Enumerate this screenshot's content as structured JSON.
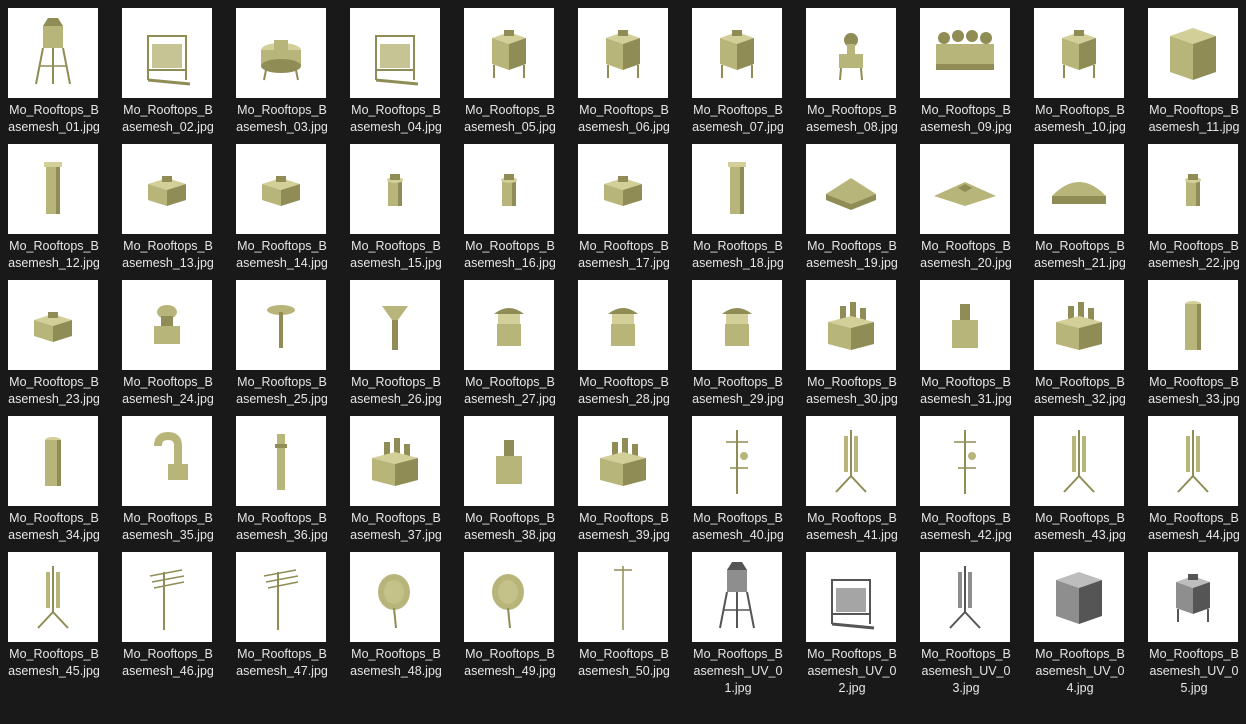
{
  "colors": {
    "background": "#191919",
    "thumb_background": "#ffffff",
    "label_text": "#e6e6e6",
    "model_fill": "#b8b57a",
    "model_shadow": "#8f8c55",
    "model_light": "#d2cf98",
    "uv_fill": "#8e8e8e",
    "uv_dark": "#555555"
  },
  "files": [
    {
      "name": "Mo_Rooftops_Basemesh_01.jpg",
      "icon": "water-tower-icon",
      "kind": "tower"
    },
    {
      "name": "Mo_Rooftops_Basemesh_02.jpg",
      "icon": "cooling-unit-frame-icon",
      "kind": "frame"
    },
    {
      "name": "Mo_Rooftops_Basemesh_03.jpg",
      "icon": "round-cooling-tower-icon",
      "kind": "drum"
    },
    {
      "name": "Mo_Rooftops_Basemesh_04.jpg",
      "icon": "cooling-unit-stand-icon",
      "kind": "frame"
    },
    {
      "name": "Mo_Rooftops_Basemesh_05.jpg",
      "icon": "box-unit-stand-icon",
      "kind": "box"
    },
    {
      "name": "Mo_Rooftops_Basemesh_06.jpg",
      "icon": "box-unit-legs-icon",
      "kind": "box"
    },
    {
      "name": "Mo_Rooftops_Basemesh_07.jpg",
      "icon": "tall-cooling-unit-icon",
      "kind": "box"
    },
    {
      "name": "Mo_Rooftops_Basemesh_08.jpg",
      "icon": "fan-stand-icon",
      "kind": "fanstand"
    },
    {
      "name": "Mo_Rooftops_Basemesh_09.jpg",
      "icon": "multi-fan-unit-icon",
      "kind": "multifan"
    },
    {
      "name": "Mo_Rooftops_Basemesh_10.jpg",
      "icon": "pipe-unit-icon",
      "kind": "box"
    },
    {
      "name": "Mo_Rooftops_Basemesh_11.jpg",
      "icon": "cube-unit-icon",
      "kind": "cube"
    },
    {
      "name": "Mo_Rooftops_Basemesh_12.jpg",
      "icon": "vent-column-icon",
      "kind": "column"
    },
    {
      "name": "Mo_Rooftops_Basemesh_13.jpg",
      "icon": "vent-box-icon",
      "kind": "lowbox"
    },
    {
      "name": "Mo_Rooftops_Basemesh_14.jpg",
      "icon": "vent-box-icon",
      "kind": "lowbox"
    },
    {
      "name": "Mo_Rooftops_Basemesh_15.jpg",
      "icon": "small-vent-icon",
      "kind": "smallvent"
    },
    {
      "name": "Mo_Rooftops_Basemesh_16.jpg",
      "icon": "small-vent-icon",
      "kind": "smallvent"
    },
    {
      "name": "Mo_Rooftops_Basemesh_17.jpg",
      "icon": "double-box-icon",
      "kind": "lowbox"
    },
    {
      "name": "Mo_Rooftops_Basemesh_18.jpg",
      "icon": "vent-column-icon",
      "kind": "column"
    },
    {
      "name": "Mo_Rooftops_Basemesh_19.jpg",
      "icon": "roof-hatch-icon",
      "kind": "hatch"
    },
    {
      "name": "Mo_Rooftops_Basemesh_20.jpg",
      "icon": "flat-hatch-icon",
      "kind": "flathatch"
    },
    {
      "name": "Mo_Rooftops_Basemesh_21.jpg",
      "icon": "barrel-roof-icon",
      "kind": "barrel"
    },
    {
      "name": "Mo_Rooftops_Basemesh_22.jpg",
      "icon": "fan-box-icon",
      "kind": "smallvent"
    },
    {
      "name": "Mo_Rooftops_Basemesh_23.jpg",
      "icon": "fan-box-icon",
      "kind": "lowbox"
    },
    {
      "name": "Mo_Rooftops_Basemesh_24.jpg",
      "icon": "mushroom-vent-icon",
      "kind": "mushroom"
    },
    {
      "name": "Mo_Rooftops_Basemesh_25.jpg",
      "icon": "pole-vent-icon",
      "kind": "polevent"
    },
    {
      "name": "Mo_Rooftops_Basemesh_26.jpg",
      "icon": "funnel-vent-icon",
      "kind": "funnel"
    },
    {
      "name": "Mo_Rooftops_Basemesh_27.jpg",
      "icon": "chimney-cap-icon",
      "kind": "chimneycap"
    },
    {
      "name": "Mo_Rooftops_Basemesh_28.jpg",
      "icon": "chimney-cap-icon",
      "kind": "chimneycap"
    },
    {
      "name": "Mo_Rooftops_Basemesh_29.jpg",
      "icon": "arched-cap-icon",
      "kind": "chimneycap"
    },
    {
      "name": "Mo_Rooftops_Basemesh_30.jpg",
      "icon": "multi-chimney-icon",
      "kind": "multichimney"
    },
    {
      "name": "Mo_Rooftops_Basemesh_31.jpg",
      "icon": "chimney-icon",
      "kind": "chimney"
    },
    {
      "name": "Mo_Rooftops_Basemesh_32.jpg",
      "icon": "multi-chimney-icon",
      "kind": "multichimney"
    },
    {
      "name": "Mo_Rooftops_Basemesh_33.jpg",
      "icon": "chimney-pipe-icon",
      "kind": "pipe"
    },
    {
      "name": "Mo_Rooftops_Basemesh_34.jpg",
      "icon": "chimney-pipe-icon",
      "kind": "pipe"
    },
    {
      "name": "Mo_Rooftops_Basemesh_35.jpg",
      "icon": "gooseneck-vent-icon",
      "kind": "gooseneck"
    },
    {
      "name": "Mo_Rooftops_Basemesh_36.jpg",
      "icon": "thin-pipe-icon",
      "kind": "thinpipe"
    },
    {
      "name": "Mo_Rooftops_Basemesh_37.jpg",
      "icon": "chimney-block-icon",
      "kind": "multichimney"
    },
    {
      "name": "Mo_Rooftops_Basemesh_38.jpg",
      "icon": "chimney-block-icon",
      "kind": "chimney"
    },
    {
      "name": "Mo_Rooftops_Basemesh_39.jpg",
      "icon": "chimney-block-icon",
      "kind": "multichimney"
    },
    {
      "name": "Mo_Rooftops_Basemesh_40.jpg",
      "icon": "antenna-icon",
      "kind": "antenna"
    },
    {
      "name": "Mo_Rooftops_Basemesh_41.jpg",
      "icon": "antenna-mast-icon",
      "kind": "mast"
    },
    {
      "name": "Mo_Rooftops_Basemesh_42.jpg",
      "icon": "antenna-icon",
      "kind": "antenna"
    },
    {
      "name": "Mo_Rooftops_Basemesh_43.jpg",
      "icon": "antenna-mast-icon",
      "kind": "mast"
    },
    {
      "name": "Mo_Rooftops_Basemesh_44.jpg",
      "icon": "antenna-mast-icon",
      "kind": "mast"
    },
    {
      "name": "Mo_Rooftops_Basemesh_45.jpg",
      "icon": "antenna-mast-icon",
      "kind": "mast"
    },
    {
      "name": "Mo_Rooftops_Basemesh_46.jpg",
      "icon": "tv-antenna-icon",
      "kind": "tvantenna"
    },
    {
      "name": "Mo_Rooftops_Basemesh_47.jpg",
      "icon": "tv-antenna-icon",
      "kind": "tvantenna"
    },
    {
      "name": "Mo_Rooftops_Basemesh_48.jpg",
      "icon": "satellite-dish-icon",
      "kind": "dish"
    },
    {
      "name": "Mo_Rooftops_Basemesh_49.jpg",
      "icon": "satellite-dish-icon",
      "kind": "dish"
    },
    {
      "name": "Mo_Rooftops_Basemesh_50.jpg",
      "icon": "antenna-icon",
      "kind": "thinantenna"
    },
    {
      "name": "Mo_Rooftops_Basemesh_UV_01.jpg",
      "icon": "water-tower-uv-icon",
      "kind": "tower",
      "uv": true
    },
    {
      "name": "Mo_Rooftops_Basemesh_UV_02.jpg",
      "icon": "cooling-unit-uv-icon",
      "kind": "frame",
      "uv": true
    },
    {
      "name": "Mo_Rooftops_Basemesh_UV_03.jpg",
      "icon": "antenna-mast-uv-icon",
      "kind": "mast",
      "uv": true
    },
    {
      "name": "Mo_Rooftops_Basemesh_UV_04.jpg",
      "icon": "cube-unit-uv-icon",
      "kind": "cube",
      "uv": true
    },
    {
      "name": "Mo_Rooftops_Basemesh_UV_05.jpg",
      "icon": "cooling-unit-uv-icon",
      "kind": "box",
      "uv": true
    }
  ]
}
